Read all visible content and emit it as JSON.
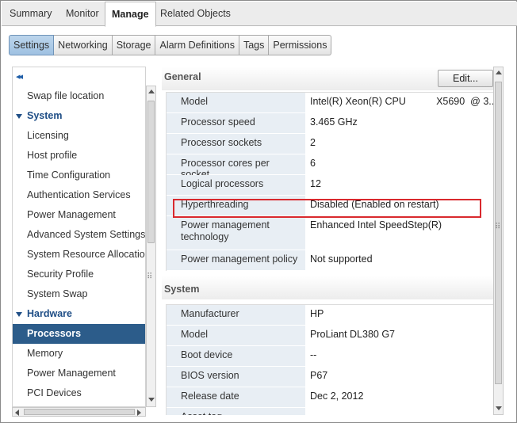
{
  "top_tabs": [
    {
      "label": "Summary"
    },
    {
      "label": "Monitor"
    },
    {
      "label": "Manage"
    },
    {
      "label": "Related Objects"
    }
  ],
  "sub_tabs": [
    {
      "label": "Settings"
    },
    {
      "label": "Networking"
    },
    {
      "label": "Storage"
    },
    {
      "label": "Alarm Definitions"
    },
    {
      "label": "Tags"
    },
    {
      "label": "Permissions"
    }
  ],
  "nav": {
    "collapse_glyph": "◂◂",
    "items": [
      {
        "label": "Swap file location"
      },
      {
        "label": "System"
      },
      {
        "label": "Licensing"
      },
      {
        "label": "Host profile"
      },
      {
        "label": "Time Configuration"
      },
      {
        "label": "Authentication Services"
      },
      {
        "label": "Power Management"
      },
      {
        "label": "Advanced System Settings"
      },
      {
        "label": "System Resource Allocation"
      },
      {
        "label": "Security Profile"
      },
      {
        "label": "System Swap"
      },
      {
        "label": "Hardware"
      },
      {
        "label": "Processors"
      },
      {
        "label": "Memory"
      },
      {
        "label": "Power Management"
      },
      {
        "label": "PCI Devices"
      }
    ]
  },
  "general": {
    "title": "General",
    "edit_label": "Edit...",
    "rows": [
      {
        "label": "Model",
        "value": "Intel(R) Xeon(R) CPU           X5690  @ 3..."
      },
      {
        "label": "Processor speed",
        "value": "3.465 GHz"
      },
      {
        "label": "Processor sockets",
        "value": "2"
      },
      {
        "label": "Processor cores per socket",
        "value": "6"
      },
      {
        "label": "Logical processors",
        "value": "12"
      },
      {
        "label": "Hyperthreading",
        "value": "Disabled (Enabled on restart)"
      },
      {
        "label": "Power management technology",
        "value": "Enhanced Intel SpeedStep(R)"
      },
      {
        "label": "Power management policy",
        "value": "Not supported"
      }
    ]
  },
  "system": {
    "title": "System",
    "rows": [
      {
        "label": "Manufacturer",
        "value": "HP"
      },
      {
        "label": "Model",
        "value": "ProLiant DL380 G7"
      },
      {
        "label": "Boot device",
        "value": "--"
      },
      {
        "label": "BIOS version",
        "value": "P67"
      },
      {
        "label": "Release date",
        "value": "Dec 2, 2012"
      },
      {
        "label": "Asset tag",
        "value": ""
      }
    ]
  },
  "colors": {
    "selected_nav": "#2c5c8a",
    "header_blue": "#1f4e86",
    "highlight_red": "#d9292e",
    "label_bg": "#e8eef4"
  }
}
